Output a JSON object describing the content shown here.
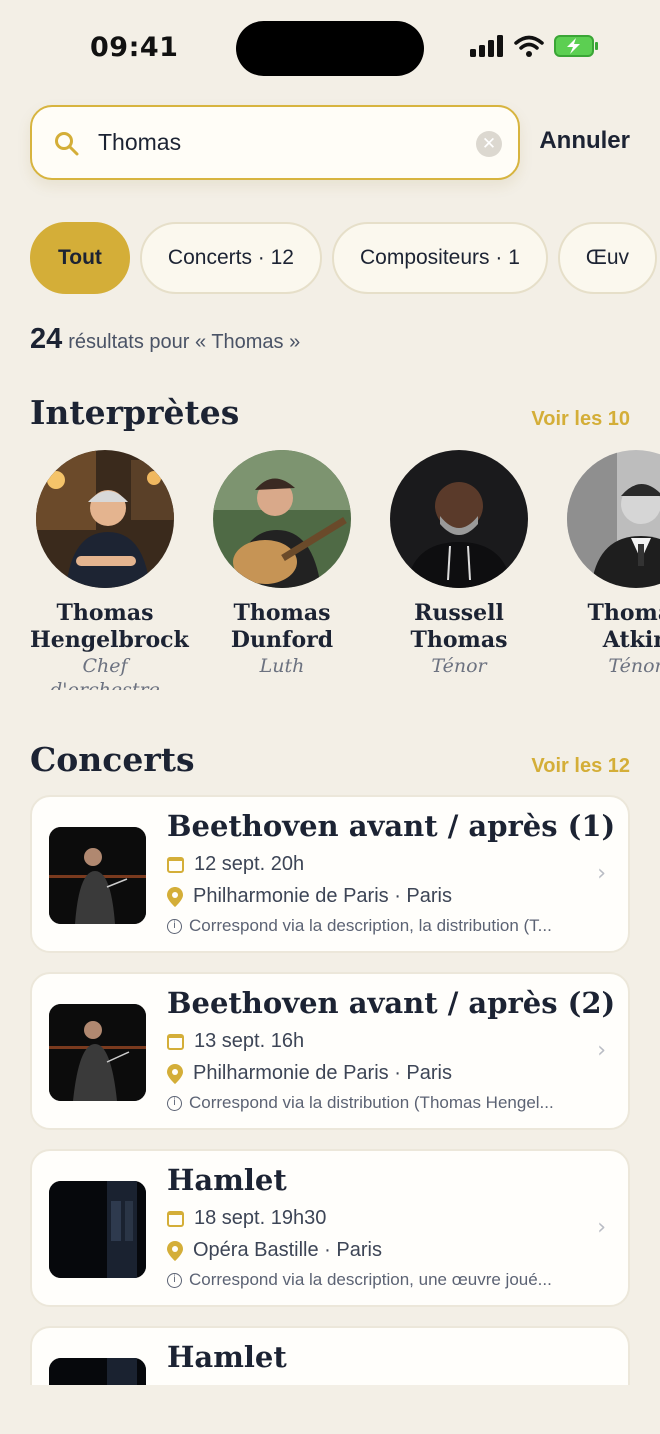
{
  "status_bar": {
    "time": "09:41"
  },
  "search": {
    "query": "Thomas",
    "cancel_label": "Annuler"
  },
  "filters": [
    {
      "label": "Tout",
      "active": true
    },
    {
      "label": "Concerts · 12",
      "active": false
    },
    {
      "label": "Compositeurs · 1",
      "active": false
    },
    {
      "label": "Œuv",
      "active": false
    }
  ],
  "results": {
    "count": "24",
    "text": "résultats pour « Thomas »"
  },
  "performers_section": {
    "title": "Interprètes",
    "see_all": "Voir les 10",
    "items": [
      {
        "first": "Thomas",
        "last": "Hengelbrock",
        "role": "Chef d'orchestre",
        "photo": "portrait-conductor"
      },
      {
        "first": "Thomas",
        "last": "Dunford",
        "role": "Luth",
        "photo": "portrait-lute-player"
      },
      {
        "first": "Russell",
        "last": "Thomas",
        "role": "Ténor",
        "photo": "portrait-tenor"
      },
      {
        "first": "Thomas",
        "last": "Atkin",
        "role": "Ténor",
        "photo": "portrait-bw"
      }
    ]
  },
  "concerts_section": {
    "title": "Concerts",
    "see_all": "Voir les 12",
    "items": [
      {
        "title": "Beethoven avant / après (1)",
        "date": "12 sept. 20h",
        "venue": "Philharmonie de Paris · Paris",
        "match": "Correspond via la description, la distribution (T..."
      },
      {
        "title": "Beethoven avant / après (2)",
        "date": "13 sept. 16h",
        "venue": "Philharmonie de Paris · Paris",
        "match": "Correspond via la distribution (Thomas Hengel..."
      },
      {
        "title": "Hamlet",
        "date": "18 sept. 19h30",
        "venue": "Opéra Bastille · Paris",
        "match": "Correspond via la description, une œuvre joué..."
      },
      {
        "title": "Hamlet",
        "date": "",
        "venue": "",
        "match": ""
      }
    ]
  },
  "colors": {
    "accent": "#d4ae38",
    "background": "#f3efe6",
    "text": "#1c2333"
  }
}
